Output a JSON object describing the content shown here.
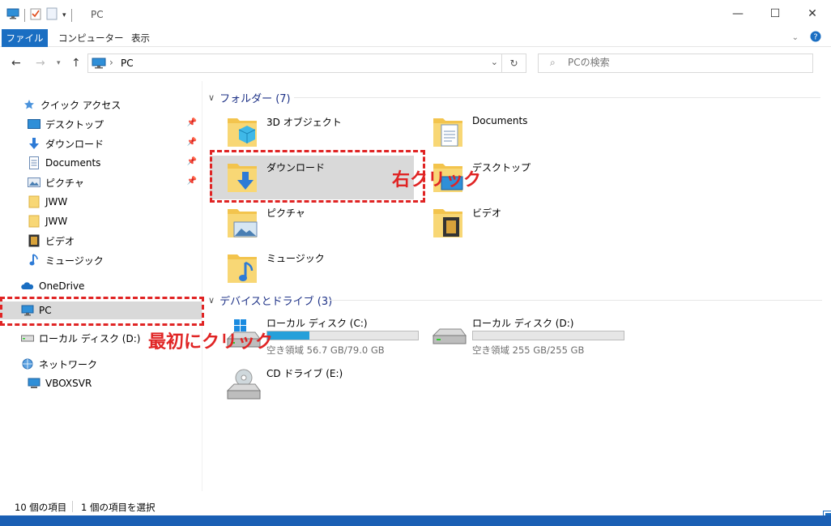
{
  "window": {
    "title": "PC",
    "controls": {
      "minimize": "—",
      "maximize": "☐",
      "close": "✕"
    }
  },
  "ribbon": {
    "tabs": [
      "ファイル",
      "コンピューター",
      "表示"
    ]
  },
  "address": {
    "path": "PC",
    "search_placeholder": "PCの検索"
  },
  "sidebar": {
    "quick_access": "クイック アクセス",
    "quick_items": [
      {
        "label": "デスクトップ",
        "icon": "desktop-icon",
        "pinned": true
      },
      {
        "label": "ダウンロード",
        "icon": "download-arrow-icon",
        "pinned": true
      },
      {
        "label": "Documents",
        "icon": "document-icon",
        "pinned": true
      },
      {
        "label": "ピクチャ",
        "icon": "pictures-icon",
        "pinned": true
      },
      {
        "label": "JWW",
        "icon": "folder-icon",
        "pinned": false
      },
      {
        "label": "JWW",
        "icon": "folder-icon",
        "pinned": false
      },
      {
        "label": "ビデオ",
        "icon": "video-icon",
        "pinned": false
      },
      {
        "label": "ミュージック",
        "icon": "music-icon",
        "pinned": false
      }
    ],
    "onedrive": "OneDrive",
    "pc": "PC",
    "local_disk": "ローカル ディスク (D:)",
    "network": "ネットワーク",
    "network_item": "VBOXSVR"
  },
  "content": {
    "folders_header": "フォルダー (7)",
    "folders": [
      {
        "name": "3D オブジェクト",
        "icon": "3d-objects-folder-icon"
      },
      {
        "name": "Documents",
        "icon": "documents-folder-icon"
      },
      {
        "name": "ダウンロード",
        "icon": "downloads-folder-icon"
      },
      {
        "name": "デスクトップ",
        "icon": "desktop-folder-icon"
      },
      {
        "name": "ピクチャ",
        "icon": "pictures-folder-icon"
      },
      {
        "name": "ビデオ",
        "icon": "videos-folder-icon"
      },
      {
        "name": "ミュージック",
        "icon": "music-folder-icon"
      }
    ],
    "devices_header": "デバイスとドライブ (3)",
    "drives": [
      {
        "name": "ローカル ディスク (C:)",
        "sub": "空き領域 56.7 GB/79.0 GB",
        "used_fraction": 0.28
      },
      {
        "name": "ローカル ディスク (D:)",
        "sub": "空き領域 255 GB/255 GB",
        "used_fraction": 0.0
      },
      {
        "name": "CD ドライブ (E:)",
        "sub": ""
      }
    ]
  },
  "status": {
    "item_count": "10 個の項目",
    "selected": "1 個の項目を選択"
  },
  "annotations": {
    "right_click": "右クリック",
    "first_click": "最初にクリック",
    "color": "#e02424"
  }
}
